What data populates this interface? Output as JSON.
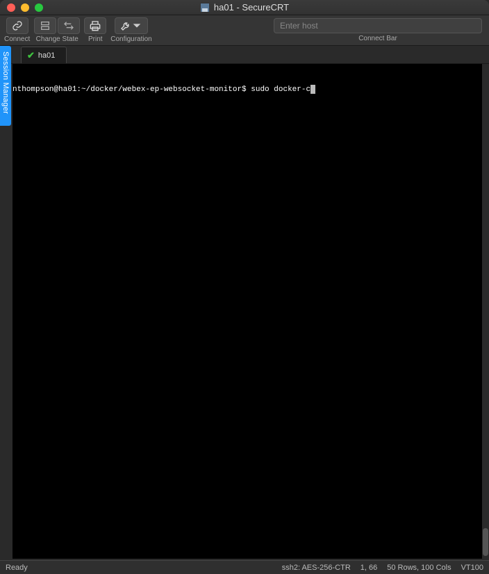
{
  "window": {
    "title": "ha01 - SecureCRT"
  },
  "toolbar": {
    "connect": "Connect",
    "change_state": "Change State",
    "print": "Print",
    "configuration": "Configuration",
    "connect_bar_label": "Connect Bar",
    "connect_placeholder": "Enter host"
  },
  "session_manager_label": "Session Manager",
  "tab": {
    "name": "ha01"
  },
  "terminal": {
    "prompt": "nthompson@ha01:~/docker/webex-ep-websocket-monitor$",
    "command": " sudo docker-c"
  },
  "status": {
    "ready": "Ready",
    "cipher": "ssh2: AES-256-CTR",
    "cursor": "1,  66",
    "size": "50 Rows, 100 Cols",
    "term": "VT100"
  }
}
